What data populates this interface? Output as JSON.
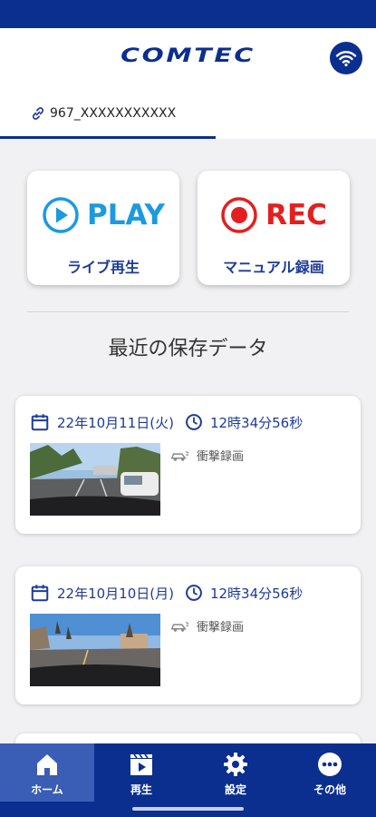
{
  "header": {
    "logo_text": "COMTEC"
  },
  "device": {
    "name": "967_XXXXXXXXXXX"
  },
  "actions": {
    "play": {
      "main": "PLAY",
      "sub": "ライブ再生"
    },
    "rec": {
      "main": "REC",
      "sub": "マニュアル録画"
    }
  },
  "recent": {
    "title": "最近の保存データ",
    "items": [
      {
        "date": "22年10月11日(火)",
        "time": "12時34分56秒",
        "type": "衝撃録画"
      },
      {
        "date": "22年10月10日(月)",
        "time": "12時34分56秒",
        "type": "衝撃録画"
      }
    ]
  },
  "nav": {
    "items": [
      {
        "label": "ホーム",
        "icon": "home-icon"
      },
      {
        "label": "再生",
        "icon": "playback-icon"
      },
      {
        "label": "設定",
        "icon": "gear-icon"
      },
      {
        "label": "その他",
        "icon": "more-icon"
      }
    ]
  },
  "colors": {
    "brand": "#0b2f8f",
    "play": "#1c9ae0",
    "rec": "#e41f1f",
    "accent_text": "#1d3b97"
  }
}
